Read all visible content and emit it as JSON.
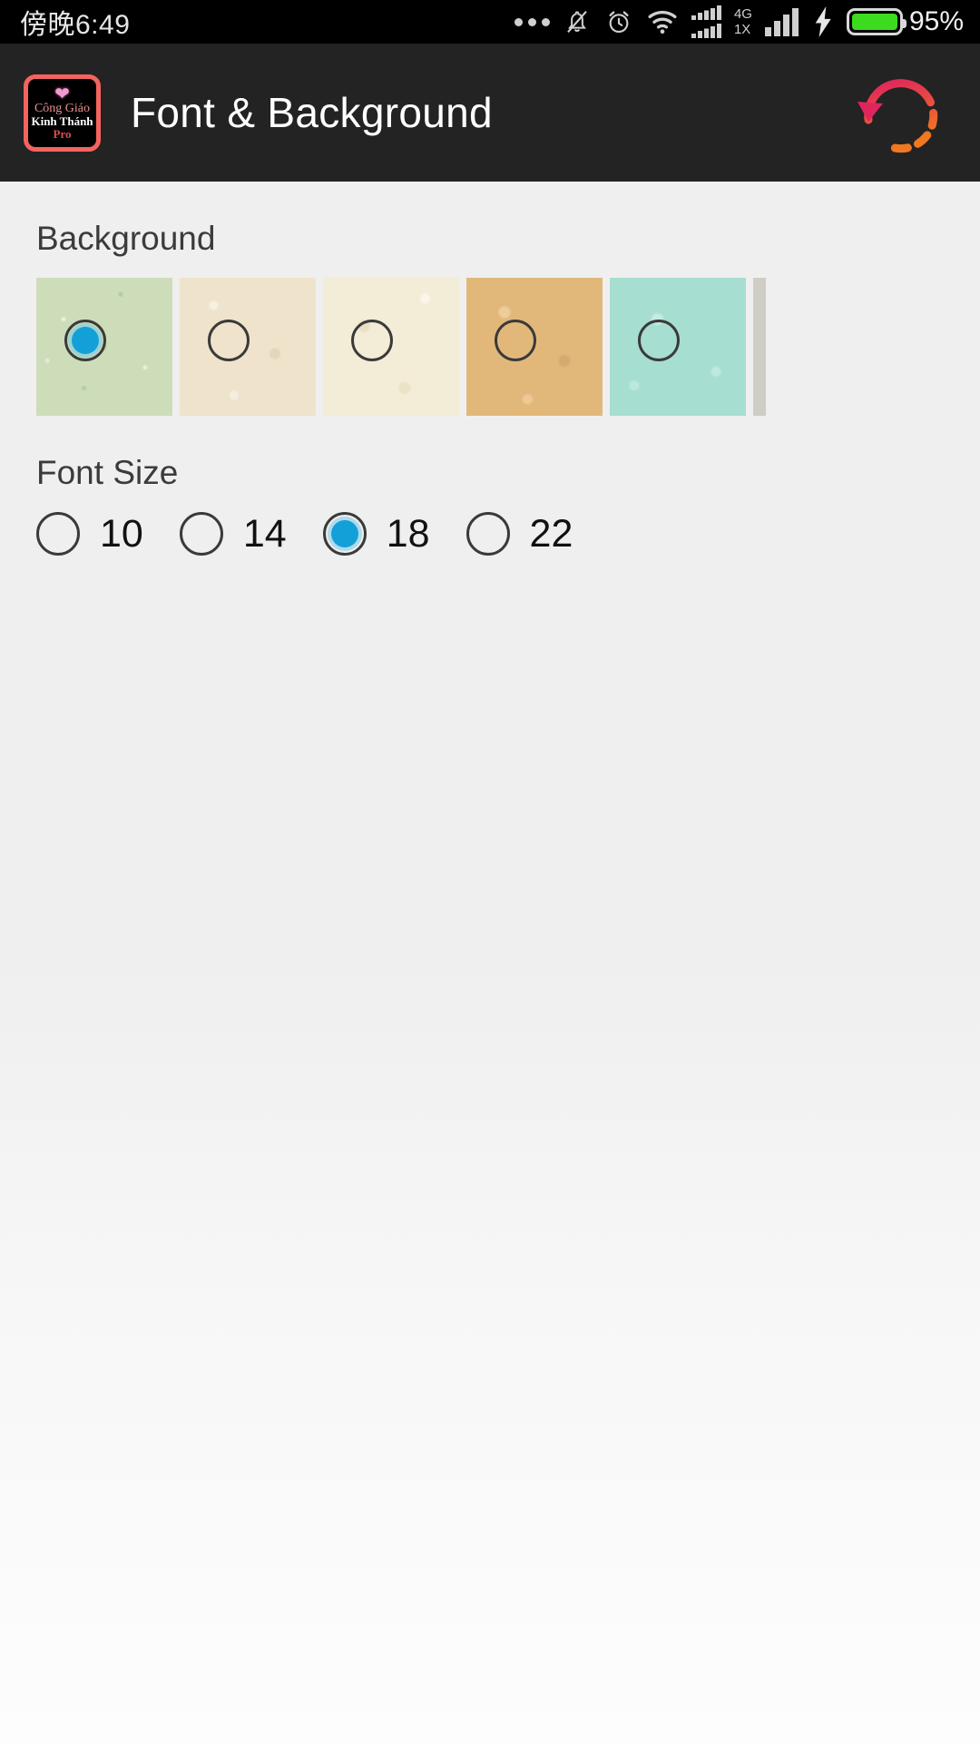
{
  "status_bar": {
    "clock": "傍晚6:49",
    "battery_percent": "95%",
    "battery_level": 95,
    "battery_color": "#3ddb1e",
    "sim1_network": "4G",
    "sim2_network": "1X",
    "icons": [
      "more-dots-icon",
      "bell-muted-icon",
      "alarm-clock-icon",
      "wifi-icon",
      "signal-dual-icon",
      "signal-icon",
      "charging-bolt-icon",
      "battery-icon"
    ]
  },
  "app_bar": {
    "title": "Font & Background",
    "logo": {
      "line1": "Công Giáo",
      "line2": "Kinh Thánh",
      "line3": "Pro",
      "heart_icon": "heart-icon",
      "border_color": "#f4645f"
    },
    "refresh": {
      "icon": "refresh-circular-arrow-icon",
      "color_start": "#e0245e",
      "color_end": "#f07820"
    },
    "background_color": "#232323"
  },
  "background_section": {
    "label": "Background",
    "selected_index": 0,
    "options": [
      {
        "name": "green-texture",
        "color": "#cdddb9",
        "selected": true
      },
      {
        "name": "cream-texture",
        "color": "#efe3cc",
        "selected": false
      },
      {
        "name": "light-cream-texture",
        "color": "#f3ecd6",
        "selected": false
      },
      {
        "name": "tan-texture",
        "color": "#e2b87a",
        "selected": false
      },
      {
        "name": "mint-texture",
        "color": "#a6ded1",
        "selected": false
      },
      {
        "name": "grey-texture",
        "color": "#cfcdc4",
        "selected": false
      }
    ]
  },
  "font_size_section": {
    "label": "Font Size",
    "selected_value": "18",
    "options": [
      {
        "value": "10",
        "selected": false
      },
      {
        "value": "14",
        "selected": false
      },
      {
        "value": "18",
        "selected": true
      },
      {
        "value": "22",
        "selected": false
      }
    ]
  },
  "colors": {
    "accent_radio": "#13a0d8",
    "page_background": "#efefef",
    "text_primary": "#111111"
  }
}
